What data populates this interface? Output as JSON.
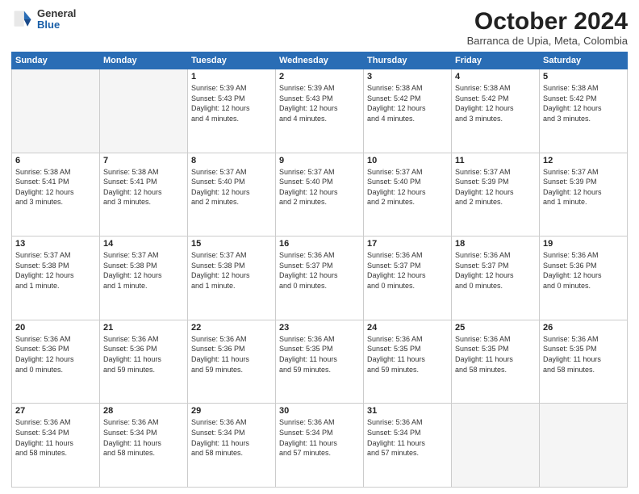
{
  "logo": {
    "general": "General",
    "blue": "Blue"
  },
  "header": {
    "title": "October 2024",
    "subtitle": "Barranca de Upia, Meta, Colombia"
  },
  "days_of_week": [
    "Sunday",
    "Monday",
    "Tuesday",
    "Wednesday",
    "Thursday",
    "Friday",
    "Saturday"
  ],
  "weeks": [
    [
      {
        "day": "",
        "info": ""
      },
      {
        "day": "",
        "info": ""
      },
      {
        "day": "1",
        "info": "Sunrise: 5:39 AM\nSunset: 5:43 PM\nDaylight: 12 hours\nand 4 minutes."
      },
      {
        "day": "2",
        "info": "Sunrise: 5:39 AM\nSunset: 5:43 PM\nDaylight: 12 hours\nand 4 minutes."
      },
      {
        "day": "3",
        "info": "Sunrise: 5:38 AM\nSunset: 5:42 PM\nDaylight: 12 hours\nand 4 minutes."
      },
      {
        "day": "4",
        "info": "Sunrise: 5:38 AM\nSunset: 5:42 PM\nDaylight: 12 hours\nand 3 minutes."
      },
      {
        "day": "5",
        "info": "Sunrise: 5:38 AM\nSunset: 5:42 PM\nDaylight: 12 hours\nand 3 minutes."
      }
    ],
    [
      {
        "day": "6",
        "info": "Sunrise: 5:38 AM\nSunset: 5:41 PM\nDaylight: 12 hours\nand 3 minutes."
      },
      {
        "day": "7",
        "info": "Sunrise: 5:38 AM\nSunset: 5:41 PM\nDaylight: 12 hours\nand 3 minutes."
      },
      {
        "day": "8",
        "info": "Sunrise: 5:37 AM\nSunset: 5:40 PM\nDaylight: 12 hours\nand 2 minutes."
      },
      {
        "day": "9",
        "info": "Sunrise: 5:37 AM\nSunset: 5:40 PM\nDaylight: 12 hours\nand 2 minutes."
      },
      {
        "day": "10",
        "info": "Sunrise: 5:37 AM\nSunset: 5:40 PM\nDaylight: 12 hours\nand 2 minutes."
      },
      {
        "day": "11",
        "info": "Sunrise: 5:37 AM\nSunset: 5:39 PM\nDaylight: 12 hours\nand 2 minutes."
      },
      {
        "day": "12",
        "info": "Sunrise: 5:37 AM\nSunset: 5:39 PM\nDaylight: 12 hours\nand 1 minute."
      }
    ],
    [
      {
        "day": "13",
        "info": "Sunrise: 5:37 AM\nSunset: 5:38 PM\nDaylight: 12 hours\nand 1 minute."
      },
      {
        "day": "14",
        "info": "Sunrise: 5:37 AM\nSunset: 5:38 PM\nDaylight: 12 hours\nand 1 minute."
      },
      {
        "day": "15",
        "info": "Sunrise: 5:37 AM\nSunset: 5:38 PM\nDaylight: 12 hours\nand 1 minute."
      },
      {
        "day": "16",
        "info": "Sunrise: 5:36 AM\nSunset: 5:37 PM\nDaylight: 12 hours\nand 0 minutes."
      },
      {
        "day": "17",
        "info": "Sunrise: 5:36 AM\nSunset: 5:37 PM\nDaylight: 12 hours\nand 0 minutes."
      },
      {
        "day": "18",
        "info": "Sunrise: 5:36 AM\nSunset: 5:37 PM\nDaylight: 12 hours\nand 0 minutes."
      },
      {
        "day": "19",
        "info": "Sunrise: 5:36 AM\nSunset: 5:36 PM\nDaylight: 12 hours\nand 0 minutes."
      }
    ],
    [
      {
        "day": "20",
        "info": "Sunrise: 5:36 AM\nSunset: 5:36 PM\nDaylight: 12 hours\nand 0 minutes."
      },
      {
        "day": "21",
        "info": "Sunrise: 5:36 AM\nSunset: 5:36 PM\nDaylight: 11 hours\nand 59 minutes."
      },
      {
        "day": "22",
        "info": "Sunrise: 5:36 AM\nSunset: 5:36 PM\nDaylight: 11 hours\nand 59 minutes."
      },
      {
        "day": "23",
        "info": "Sunrise: 5:36 AM\nSunset: 5:35 PM\nDaylight: 11 hours\nand 59 minutes."
      },
      {
        "day": "24",
        "info": "Sunrise: 5:36 AM\nSunset: 5:35 PM\nDaylight: 11 hours\nand 59 minutes."
      },
      {
        "day": "25",
        "info": "Sunrise: 5:36 AM\nSunset: 5:35 PM\nDaylight: 11 hours\nand 58 minutes."
      },
      {
        "day": "26",
        "info": "Sunrise: 5:36 AM\nSunset: 5:35 PM\nDaylight: 11 hours\nand 58 minutes."
      }
    ],
    [
      {
        "day": "27",
        "info": "Sunrise: 5:36 AM\nSunset: 5:34 PM\nDaylight: 11 hours\nand 58 minutes."
      },
      {
        "day": "28",
        "info": "Sunrise: 5:36 AM\nSunset: 5:34 PM\nDaylight: 11 hours\nand 58 minutes."
      },
      {
        "day": "29",
        "info": "Sunrise: 5:36 AM\nSunset: 5:34 PM\nDaylight: 11 hours\nand 58 minutes."
      },
      {
        "day": "30",
        "info": "Sunrise: 5:36 AM\nSunset: 5:34 PM\nDaylight: 11 hours\nand 57 minutes."
      },
      {
        "day": "31",
        "info": "Sunrise: 5:36 AM\nSunset: 5:34 PM\nDaylight: 11 hours\nand 57 minutes."
      },
      {
        "day": "",
        "info": ""
      },
      {
        "day": "",
        "info": ""
      }
    ]
  ]
}
